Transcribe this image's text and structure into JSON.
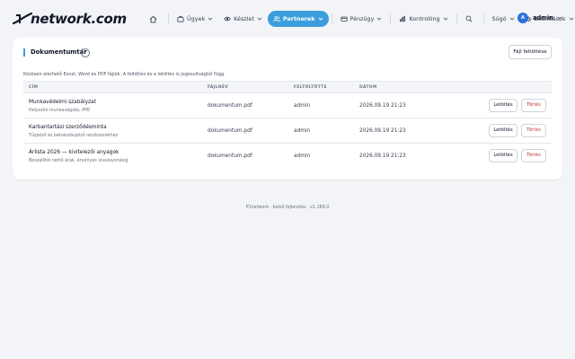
{
  "brand": {
    "name": "network.com",
    "prefix_glyph": "P"
  },
  "nav": {
    "items": [
      {
        "id": "ugyek",
        "label": "Ügyek",
        "icon": "briefcase-icon",
        "dropdown": true
      },
      {
        "id": "keszlet",
        "label": "Készlet",
        "icon": "eye-icon",
        "dropdown": true
      },
      {
        "id": "partnerek",
        "label": "Partnerek",
        "icon": "users-icon",
        "dropdown": true,
        "active": true
      },
      {
        "id": "penzugy",
        "label": "Pénzügy",
        "icon": "card-icon",
        "dropdown": true
      },
      {
        "id": "kontrolling",
        "label": "Kontrolling",
        "icon": "bar-chart-icon",
        "dropdown": true
      }
    ],
    "help_label": "Súgó",
    "settings_label": "Beállítások",
    "accent": "#3b9edc"
  },
  "user": {
    "initial": "A",
    "name": "admin"
  },
  "page": {
    "title": "Dokumentumtár",
    "help_glyph": "?",
    "upload_label": "Fájl feltöltése",
    "description": "Közösen elérhető Excel, Word és PDF fájlok. A feltöltés és a letöltés is jogosultságtól függ."
  },
  "table": {
    "columns": [
      "Cím",
      "Fájlnév",
      "Feltöltötte",
      "Dátum"
    ],
    "download_label": "Letöltés",
    "delete_label": "Törlés",
    "rows": [
      {
        "title": "Munkavédelmi szabályzat",
        "subtitle": "Helyszíni munkavégzés, PPE",
        "file": "dokumentum.pdf",
        "uploader": "admin",
        "date": "2026.09.19 21:23"
      },
      {
        "title": "Karbantartási szerződésminta",
        "subtitle": "Tűzjelző és behatolásjelző rendszerekhez",
        "file": "dokumentum.pdf",
        "uploader": "admin",
        "date": "2026.09.19 21:23"
      },
      {
        "title": "Árlista 2026 — kivitelezői anyagok",
        "subtitle": "Beszállítói nettó árak, érvényes visszavonásig",
        "file": "dokumentum.pdf",
        "uploader": "admin",
        "date": "2026.09.19 21:23"
      }
    ]
  },
  "footer": {
    "text": "P1network · belső fejlesztés · v1.169.0"
  }
}
